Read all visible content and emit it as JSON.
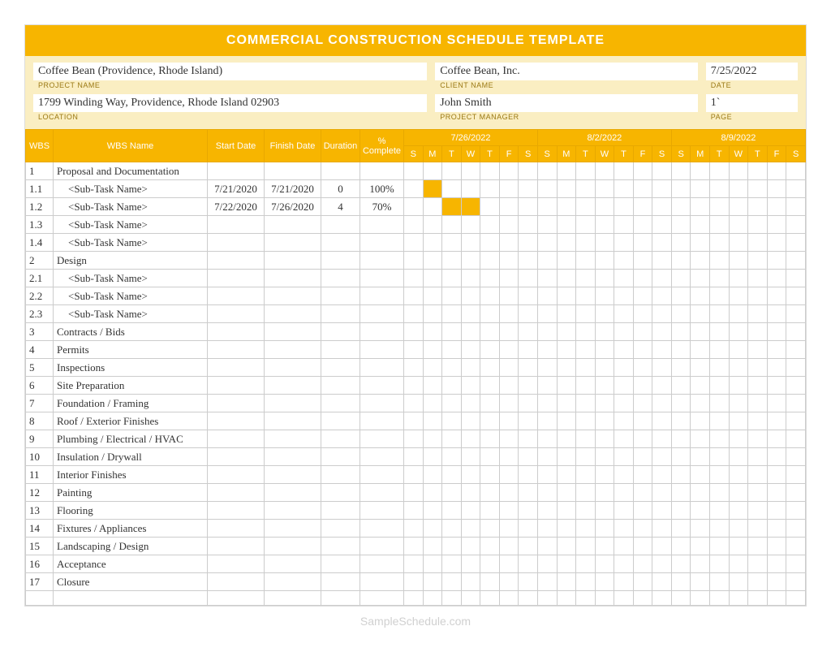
{
  "title": "COMMERCIAL CONSTRUCTION SCHEDULE TEMPLATE",
  "info": {
    "project_name_value": "Coffee Bean (Providence, Rhode Island)",
    "project_name_label": "PROJECT NAME",
    "location_value": "1799  Winding Way, Providence, Rhode Island   02903",
    "location_label": "LOCATION",
    "client_name_value": "Coffee Bean, Inc.",
    "client_name_label": "CLIENT NAME",
    "project_manager_value": "John Smith",
    "project_manager_label": "PROJECT MANAGER",
    "date_value": "7/25/2022",
    "date_label": "DATE",
    "page_value": "1`",
    "page_label": "PAGE"
  },
  "headers": {
    "wbs": "WBS",
    "wbs_name": "WBS Name",
    "start_date": "Start Date",
    "finish_date": "Finish Date",
    "duration": "Duration",
    "pct_complete": "% Complete",
    "week1": "7/26/2022",
    "week2": "8/2/2022",
    "week3": "8/9/2022",
    "days": [
      "S",
      "M",
      "T",
      "W",
      "T",
      "F",
      "S",
      "S",
      "M",
      "T",
      "W",
      "T",
      "F",
      "S",
      "S",
      "M",
      "T",
      "W",
      "T",
      "F",
      "S"
    ]
  },
  "rows": [
    {
      "wbs": "1",
      "name": "Proposal and Documentation",
      "start": "",
      "finish": "",
      "dur": "",
      "pct": "",
      "sub": false,
      "gantt": []
    },
    {
      "wbs": "1.1",
      "name": "<Sub-Task Name>",
      "start": "7/21/2020",
      "finish": "7/21/2020",
      "dur": "0",
      "pct": "100%",
      "sub": true,
      "gantt": [
        1
      ]
    },
    {
      "wbs": "1.2",
      "name": "<Sub-Task Name>",
      "start": "7/22/2020",
      "finish": "7/26/2020",
      "dur": "4",
      "pct": "70%",
      "sub": true,
      "gantt": [
        2,
        3
      ]
    },
    {
      "wbs": "1.3",
      "name": "<Sub-Task Name>",
      "start": "",
      "finish": "",
      "dur": "",
      "pct": "",
      "sub": true,
      "gantt": []
    },
    {
      "wbs": "1.4",
      "name": "<Sub-Task Name>",
      "start": "",
      "finish": "",
      "dur": "",
      "pct": "",
      "sub": true,
      "gantt": []
    },
    {
      "wbs": "2",
      "name": "Design",
      "start": "",
      "finish": "",
      "dur": "",
      "pct": "",
      "sub": false,
      "gantt": []
    },
    {
      "wbs": "2.1",
      "name": "<Sub-Task Name>",
      "start": "",
      "finish": "",
      "dur": "",
      "pct": "",
      "sub": true,
      "gantt": []
    },
    {
      "wbs": "2.2",
      "name": "<Sub-Task Name>",
      "start": "",
      "finish": "",
      "dur": "",
      "pct": "",
      "sub": true,
      "gantt": []
    },
    {
      "wbs": "2.3",
      "name": "<Sub-Task Name>",
      "start": "",
      "finish": "",
      "dur": "",
      "pct": "",
      "sub": true,
      "gantt": []
    },
    {
      "wbs": "3",
      "name": "Contracts / Bids",
      "start": "",
      "finish": "",
      "dur": "",
      "pct": "",
      "sub": false,
      "gantt": []
    },
    {
      "wbs": "4",
      "name": "Permits",
      "start": "",
      "finish": "",
      "dur": "",
      "pct": "",
      "sub": false,
      "gantt": []
    },
    {
      "wbs": "5",
      "name": "Inspections",
      "start": "",
      "finish": "",
      "dur": "",
      "pct": "",
      "sub": false,
      "gantt": []
    },
    {
      "wbs": "6",
      "name": "Site Preparation",
      "start": "",
      "finish": "",
      "dur": "",
      "pct": "",
      "sub": false,
      "gantt": []
    },
    {
      "wbs": "7",
      "name": "Foundation / Framing",
      "start": "",
      "finish": "",
      "dur": "",
      "pct": "",
      "sub": false,
      "gantt": []
    },
    {
      "wbs": "8",
      "name": "Roof / Exterior Finishes",
      "start": "",
      "finish": "",
      "dur": "",
      "pct": "",
      "sub": false,
      "gantt": []
    },
    {
      "wbs": "9",
      "name": "Plumbing / Electrical / HVAC",
      "start": "",
      "finish": "",
      "dur": "",
      "pct": "",
      "sub": false,
      "gantt": []
    },
    {
      "wbs": "10",
      "name": "Insulation / Drywall",
      "start": "",
      "finish": "",
      "dur": "",
      "pct": "",
      "sub": false,
      "gantt": []
    },
    {
      "wbs": "11",
      "name": "Interior Finishes",
      "start": "",
      "finish": "",
      "dur": "",
      "pct": "",
      "sub": false,
      "gantt": []
    },
    {
      "wbs": "12",
      "name": "Painting",
      "start": "",
      "finish": "",
      "dur": "",
      "pct": "",
      "sub": false,
      "gantt": []
    },
    {
      "wbs": "13",
      "name": "Flooring",
      "start": "",
      "finish": "",
      "dur": "",
      "pct": "",
      "sub": false,
      "gantt": []
    },
    {
      "wbs": "14",
      "name": "Fixtures / Appliances",
      "start": "",
      "finish": "",
      "dur": "",
      "pct": "",
      "sub": false,
      "gantt": []
    },
    {
      "wbs": "15",
      "name": "Landscaping / Design",
      "start": "",
      "finish": "",
      "dur": "",
      "pct": "",
      "sub": false,
      "gantt": []
    },
    {
      "wbs": "16",
      "name": "Acceptance",
      "start": "",
      "finish": "",
      "dur": "",
      "pct": "",
      "sub": false,
      "gantt": []
    },
    {
      "wbs": "17",
      "name": "Closure",
      "start": "",
      "finish": "",
      "dur": "",
      "pct": "",
      "sub": false,
      "gantt": []
    }
  ],
  "watermark": "SampleSchedule.com"
}
